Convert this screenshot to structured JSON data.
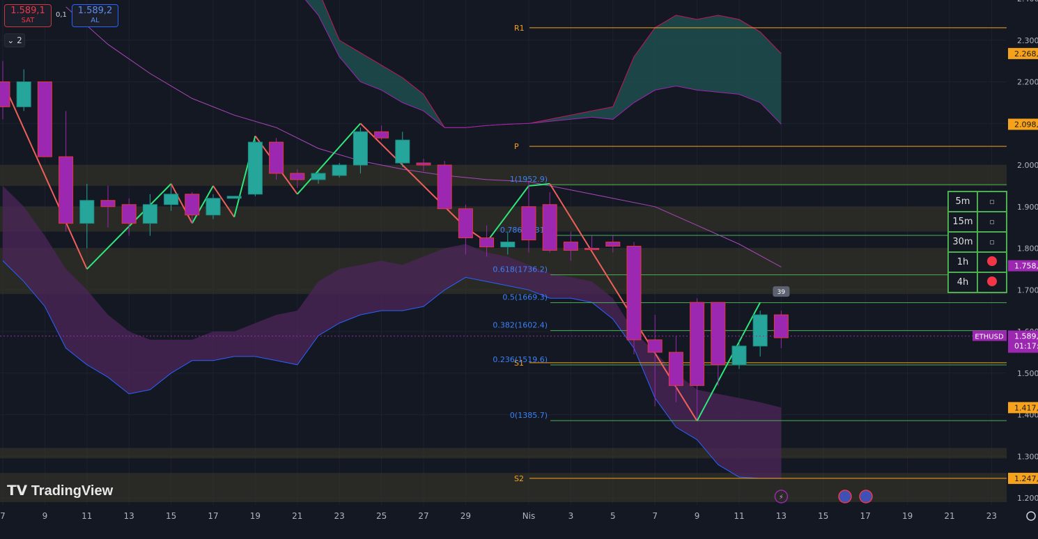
{
  "header": {
    "sell_price": "1.589,1",
    "sell_label": "SAT",
    "buy_price": "1.589,2",
    "buy_label": "AL",
    "spread": "0,1",
    "collapse_label": "2"
  },
  "logo": "TradingView",
  "timeframe_table": [
    {
      "label": "5m",
      "status": "none"
    },
    {
      "label": "15m",
      "status": "none"
    },
    {
      "label": "30m",
      "status": "none"
    },
    {
      "label": "1h",
      "status": "red"
    },
    {
      "label": "4h",
      "status": "red"
    }
  ],
  "colors": {
    "bull": "#26a69a",
    "bear": "#9c27b0",
    "zigzag_up": "#2ee87a",
    "zigzag_down": "#f0605a",
    "pivot": "#f7a21b",
    "fib": "#4caf50",
    "cloud_up": "#1d4e4e",
    "cloud_dn": "#4a2656"
  },
  "chart_data": {
    "type": "candlestick",
    "symbol": "ETHUSD",
    "price_label": "1.589,",
    "countdown": "01:17:",
    "ylim": [
      1190,
      2410
    ],
    "y_ticks": [
      {
        "v": 1200,
        "t": "1.200,"
      },
      {
        "v": 1300,
        "t": "1.300,"
      },
      {
        "v": 1400,
        "t": "1.400,"
      },
      {
        "v": 1500,
        "t": "1.500,"
      },
      {
        "v": 1600,
        "t": "1.600,"
      },
      {
        "v": 1700,
        "t": "1.700,"
      },
      {
        "v": 1800,
        "t": "1.800,"
      },
      {
        "v": 1900,
        "t": "1.900,"
      },
      {
        "v": 2000,
        "t": "2.000,"
      },
      {
        "v": 2100,
        "t": "2.100,"
      },
      {
        "v": 2200,
        "t": "2.200,"
      },
      {
        "v": 2300,
        "t": "2.300,"
      },
      {
        "v": 2400,
        "t": "2.400,"
      }
    ],
    "y_badges": [
      {
        "v": 2268,
        "t": "2.268,",
        "color": "#f7a21b"
      },
      {
        "v": 2098,
        "t": "2.098,",
        "color": "#f7a21b"
      },
      {
        "v": 1758,
        "t": "1.758,",
        "color": "#9c27b0"
      },
      {
        "v": 1417,
        "t": "1.417,",
        "color": "#f7a21b"
      },
      {
        "v": 1247,
        "t": "1.247,",
        "color": "#f7a21b"
      }
    ],
    "x_ticks": [
      {
        "i": 0,
        "t": "7"
      },
      {
        "i": 2,
        "t": "9"
      },
      {
        "i": 4,
        "t": "11"
      },
      {
        "i": 6,
        "t": "13"
      },
      {
        "i": 8,
        "t": "15"
      },
      {
        "i": 10,
        "t": "17"
      },
      {
        "i": 12,
        "t": "19"
      },
      {
        "i": 14,
        "t": "21"
      },
      {
        "i": 16,
        "t": "23"
      },
      {
        "i": 18,
        "t": "25"
      },
      {
        "i": 20,
        "t": "27"
      },
      {
        "i": 22,
        "t": "29"
      },
      {
        "i": 25,
        "t": "Nis"
      },
      {
        "i": 27,
        "t": "3"
      },
      {
        "i": 29,
        "t": "5"
      },
      {
        "i": 31,
        "t": "7"
      },
      {
        "i": 33,
        "t": "9"
      },
      {
        "i": 35,
        "t": "11"
      },
      {
        "i": 37,
        "t": "13"
      },
      {
        "i": 39,
        "t": "15"
      },
      {
        "i": 41,
        "t": "17"
      },
      {
        "i": 43,
        "t": "19"
      },
      {
        "i": 45,
        "t": "21"
      },
      {
        "i": 47,
        "t": "23"
      }
    ],
    "candles": [
      {
        "i": 0,
        "o": 2200,
        "h": 2250,
        "l": 2110,
        "c": 2140
      },
      {
        "i": 1,
        "o": 2140,
        "h": 2230,
        "l": 2130,
        "c": 2200
      },
      {
        "i": 2,
        "o": 2200,
        "h": 2200,
        "l": 2020,
        "c": 2020
      },
      {
        "i": 3,
        "o": 2020,
        "h": 2130,
        "l": 1840,
        "c": 1860
      },
      {
        "i": 4,
        "o": 1860,
        "h": 1955,
        "l": 1800,
        "c": 1915
      },
      {
        "i": 5,
        "o": 1915,
        "h": 1950,
        "l": 1850,
        "c": 1900
      },
      {
        "i": 6,
        "o": 1905,
        "h": 1920,
        "l": 1830,
        "c": 1860
      },
      {
        "i": 7,
        "o": 1860,
        "h": 1930,
        "l": 1830,
        "c": 1905
      },
      {
        "i": 8,
        "o": 1905,
        "h": 1950,
        "l": 1890,
        "c": 1930
      },
      {
        "i": 9,
        "o": 1930,
        "h": 1935,
        "l": 1860,
        "c": 1880
      },
      {
        "i": 10,
        "o": 1880,
        "h": 1930,
        "l": 1870,
        "c": 1920
      },
      {
        "i": 11,
        "o": 1920,
        "h": 1925,
        "l": 1920,
        "c": 1925
      },
      {
        "i": 12,
        "o": 1930,
        "h": 2060,
        "l": 1925,
        "c": 2055
      },
      {
        "i": 13,
        "o": 2055,
        "h": 2065,
        "l": 1965,
        "c": 1980
      },
      {
        "i": 14,
        "o": 1980,
        "h": 1990,
        "l": 1945,
        "c": 1965
      },
      {
        "i": 15,
        "o": 1965,
        "h": 1985,
        "l": 1955,
        "c": 1980
      },
      {
        "i": 16,
        "o": 1975,
        "h": 2005,
        "l": 1970,
        "c": 2000
      },
      {
        "i": 17,
        "o": 2000,
        "h": 2090,
        "l": 1980,
        "c": 2080
      },
      {
        "i": 18,
        "o": 2080,
        "h": 2095,
        "l": 2060,
        "c": 2065
      },
      {
        "i": 19,
        "o": 2005,
        "h": 2080,
        "l": 1995,
        "c": 2060
      },
      {
        "i": 20,
        "o": 2005,
        "h": 2015,
        "l": 1985,
        "c": 2000
      },
      {
        "i": 21,
        "o": 2000,
        "h": 2010,
        "l": 1895,
        "c": 1895
      },
      {
        "i": 22,
        "o": 1895,
        "h": 1905,
        "l": 1785,
        "c": 1825
      },
      {
        "i": 23,
        "o": 1825,
        "h": 1855,
        "l": 1780,
        "c": 1803
      },
      {
        "i": 24,
        "o": 1803,
        "h": 1840,
        "l": 1785,
        "c": 1815
      },
      {
        "i": 25,
        "o": 1900,
        "h": 1960,
        "l": 1790,
        "c": 1820
      },
      {
        "i": 26,
        "o": 1905,
        "h": 1935,
        "l": 1790,
        "c": 1795
      },
      {
        "i": 27,
        "o": 1815,
        "h": 1840,
        "l": 1770,
        "c": 1795
      },
      {
        "i": 28,
        "o": 1800,
        "h": 1830,
        "l": 1795,
        "c": 1798
      },
      {
        "i": 29,
        "o": 1815,
        "h": 1830,
        "l": 1790,
        "c": 1805
      },
      {
        "i": 30,
        "o": 1805,
        "h": 1815,
        "l": 1545,
        "c": 1580
      },
      {
        "i": 31,
        "o": 1580,
        "h": 1640,
        "l": 1420,
        "c": 1550
      },
      {
        "i": 32,
        "o": 1550,
        "h": 1590,
        "l": 1430,
        "c": 1470
      },
      {
        "i": 33,
        "o": 1670,
        "h": 1680,
        "l": 1390,
        "c": 1470
      },
      {
        "i": 34,
        "o": 1670,
        "h": 1670,
        "l": 1470,
        "c": 1520
      },
      {
        "i": 35,
        "o": 1520,
        "h": 1580,
        "l": 1510,
        "c": 1565
      },
      {
        "i": 36,
        "o": 1565,
        "h": 1650,
        "l": 1540,
        "c": 1640
      },
      {
        "i": 37,
        "o": 1640,
        "h": 1650,
        "l": 1560,
        "c": 1585
      }
    ],
    "zigzag": [
      [
        0,
        2200
      ],
      [
        4,
        1750
      ],
      [
        8,
        1955
      ],
      [
        9,
        1860
      ],
      [
        10,
        1950
      ],
      [
        11,
        1875
      ],
      [
        12,
        2070
      ],
      [
        14,
        1930
      ],
      [
        17,
        2100
      ],
      [
        22,
        1850
      ],
      [
        23,
        1815
      ],
      [
        25,
        1950
      ],
      [
        26,
        1955
      ],
      [
        33,
        1385
      ],
      [
        36,
        1670
      ]
    ],
    "cloud": {
      "top": [
        [
          14,
          2460
        ],
        [
          15,
          2420
        ],
        [
          16,
          2300
        ],
        [
          17,
          2270
        ],
        [
          18,
          2240
        ],
        [
          19,
          2210
        ],
        [
          20,
          2170
        ],
        [
          21,
          2090
        ],
        [
          22,
          2090
        ],
        [
          23,
          2095
        ],
        [
          24,
          2098
        ],
        [
          25,
          2100
        ],
        [
          26,
          2110
        ],
        [
          27,
          2120
        ],
        [
          28,
          2130
        ],
        [
          29,
          2140
        ],
        [
          30,
          2260
        ],
        [
          31,
          2330
        ],
        [
          32,
          2360
        ],
        [
          33,
          2350
        ],
        [
          34,
          2360
        ],
        [
          35,
          2350
        ],
        [
          36,
          2320
        ],
        [
          37,
          2268
        ]
      ],
      "bottom": [
        [
          14,
          2420
        ],
        [
          15,
          2360
        ],
        [
          16,
          2260
        ],
        [
          17,
          2200
        ],
        [
          18,
          2180
        ],
        [
          19,
          2150
        ],
        [
          20,
          2130
        ],
        [
          21,
          2090
        ],
        [
          22,
          2090
        ],
        [
          23,
          2095
        ],
        [
          24,
          2098
        ],
        [
          25,
          2100
        ],
        [
          26,
          2105
        ],
        [
          27,
          2110
        ],
        [
          28,
          2115
        ],
        [
          29,
          2110
        ],
        [
          30,
          2150
        ],
        [
          31,
          2180
        ],
        [
          32,
          2190
        ],
        [
          33,
          2180
        ],
        [
          34,
          2175
        ],
        [
          35,
          2170
        ],
        [
          36,
          2150
        ],
        [
          37,
          2098
        ]
      ]
    },
    "lower_band": {
      "top": [
        [
          0,
          1950
        ],
        [
          1,
          1900
        ],
        [
          2,
          1830
        ],
        [
          3,
          1750
        ],
        [
          4,
          1700
        ],
        [
          5,
          1640
        ],
        [
          6,
          1600
        ],
        [
          7,
          1580
        ],
        [
          8,
          1580
        ],
        [
          9,
          1580
        ],
        [
          10,
          1600
        ],
        [
          11,
          1600
        ],
        [
          12,
          1620
        ],
        [
          13,
          1640
        ],
        [
          14,
          1650
        ],
        [
          15,
          1720
        ],
        [
          16,
          1750
        ],
        [
          17,
          1760
        ],
        [
          18,
          1770
        ],
        [
          19,
          1760
        ],
        [
          20,
          1780
        ],
        [
          21,
          1800
        ],
        [
          22,
          1810
        ],
        [
          23,
          1790
        ],
        [
          24,
          1780
        ],
        [
          25,
          1760
        ],
        [
          26,
          1740
        ],
        [
          27,
          1730
        ],
        [
          28,
          1720
        ],
        [
          29,
          1680
        ],
        [
          30,
          1600
        ],
        [
          31,
          1550
        ],
        [
          32,
          1500
        ],
        [
          33,
          1460
        ],
        [
          34,
          1450
        ],
        [
          35,
          1440
        ],
        [
          36,
          1430
        ],
        [
          37,
          1417
        ]
      ],
      "bottom": [
        [
          0,
          1770
        ],
        [
          1,
          1720
        ],
        [
          2,
          1660
        ],
        [
          3,
          1560
        ],
        [
          4,
          1520
        ],
        [
          5,
          1490
        ],
        [
          6,
          1450
        ],
        [
          7,
          1460
        ],
        [
          8,
          1500
        ],
        [
          9,
          1530
        ],
        [
          10,
          1530
        ],
        [
          11,
          1540
        ],
        [
          12,
          1540
        ],
        [
          13,
          1530
        ],
        [
          14,
          1520
        ],
        [
          15,
          1590
        ],
        [
          16,
          1620
        ],
        [
          17,
          1640
        ],
        [
          18,
          1650
        ],
        [
          19,
          1650
        ],
        [
          20,
          1660
        ],
        [
          21,
          1700
        ],
        [
          22,
          1730
        ],
        [
          23,
          1720
        ],
        [
          24,
          1710
        ],
        [
          25,
          1700
        ],
        [
          26,
          1680
        ],
        [
          27,
          1680
        ],
        [
          28,
          1670
        ],
        [
          29,
          1630
        ],
        [
          30,
          1560
        ],
        [
          31,
          1440
        ],
        [
          32,
          1370
        ],
        [
          33,
          1340
        ],
        [
          34,
          1280
        ],
        [
          35,
          1250
        ],
        [
          36,
          1247
        ],
        [
          37,
          1247
        ]
      ]
    },
    "ma_line": [
      [
        3,
        2380
      ],
      [
        5,
        2290
      ],
      [
        7,
        2220
      ],
      [
        9,
        2160
      ],
      [
        11,
        2120
      ],
      [
        13,
        2090
      ],
      [
        15,
        2040
      ],
      [
        17,
        2010
      ],
      [
        19,
        1990
      ],
      [
        21,
        1975
      ],
      [
        23,
        1965
      ],
      [
        25,
        1960
      ],
      [
        27,
        1940
      ],
      [
        29,
        1920
      ],
      [
        31,
        1900
      ],
      [
        33,
        1855
      ],
      [
        35,
        1810
      ],
      [
        37,
        1755
      ]
    ],
    "pivots": [
      {
        "label": "R1",
        "v": 2330
      },
      {
        "label": "P",
        "v": 2045
      },
      {
        "label": "S1",
        "v": 1525
      },
      {
        "label": "S2",
        "v": 1247
      }
    ],
    "fib_levels": [
      {
        "label": "1(1952.9)",
        "v": 1952.9
      },
      {
        "label": "0.786(1831)",
        "v": 1831
      },
      {
        "label": "0.618(1736.2)",
        "v": 1736.2
      },
      {
        "label": "0.5(1669.3)",
        "v": 1669.3
      },
      {
        "label": "0.382(1602.4)",
        "v": 1602.4
      },
      {
        "label": "0.236(1519.6)",
        "v": 1519.6
      },
      {
        "label": "0(1385.7)",
        "v": 1385.7
      }
    ],
    "zones": [
      [
        1950,
        2000
      ],
      [
        1840,
        1900
      ],
      [
        1690,
        1800
      ],
      [
        1295,
        1320
      ],
      [
        1190,
        1260
      ]
    ],
    "current_price": 1589,
    "annotation": "39"
  }
}
